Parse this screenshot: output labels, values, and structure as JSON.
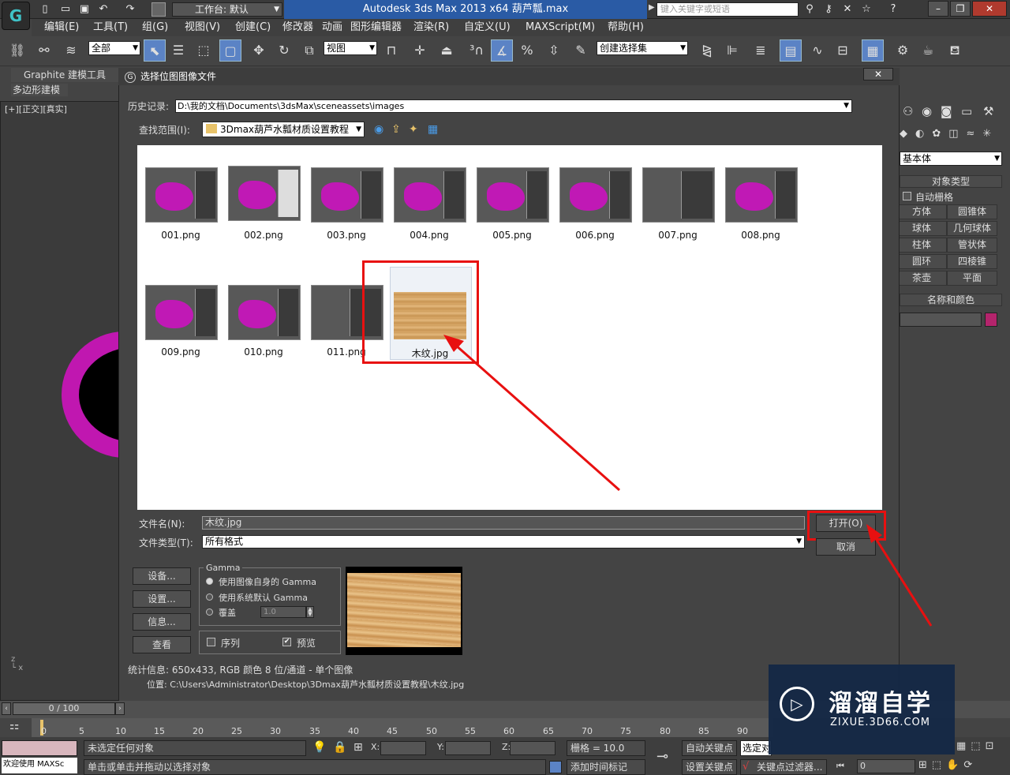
{
  "app": {
    "workspace": "工作台: 默认",
    "title": "Autodesk 3ds Max  2013 x64      葫芦瓢.max",
    "search_placeholder": "键入关键字或短语"
  },
  "menu": [
    "编辑(E)",
    "工具(T)",
    "组(G)",
    "视图(V)",
    "创建(C)",
    "修改器",
    "动画",
    "图形编辑器",
    "渲染(R)",
    "自定义(U)",
    "MAXScript(M)",
    "帮助(H)"
  ],
  "toolbar": {
    "selection_filter": "全部",
    "ref_coord": "视图",
    "selection_set": "创建选择集"
  },
  "ribbon": {
    "graphite_tab": "Graphite 建模工具",
    "poly_tab": "多边形建模"
  },
  "viewport": {
    "label": "[+][正交][真实]"
  },
  "right_panel": {
    "dropdown": "基本体",
    "object_type_header": "对象类型",
    "auto_grid": "自动栅格",
    "buttons": [
      [
        "方体",
        "圆锥体"
      ],
      [
        "球体",
        "几何球体"
      ],
      [
        "柱体",
        "管状体"
      ],
      [
        "圆环",
        "四棱锥"
      ],
      [
        "茶壶",
        "平面"
      ]
    ],
    "name_color_header": "名称和颜色",
    "object_color": "#b4246c"
  },
  "dialog": {
    "title": "选择位图图像文件",
    "history_label": "历史记录:",
    "history_value": "D:\\我的文档\\Documents\\3dsMax\\sceneassets\\images",
    "lookin_label": "查找范围(I):",
    "lookin_value": "3Dmax葫芦水瓢材质设置教程",
    "files": [
      "001.png",
      "002.png",
      "003.png",
      "004.png",
      "005.png",
      "006.png",
      "007.png",
      "008.png",
      "009.png",
      "010.png",
      "011.png",
      "木纹.jpg"
    ],
    "filename_label": "文件名(N):",
    "filename_value": "木纹.jpg",
    "filetype_label": "文件类型(T):",
    "filetype_value": "所有格式",
    "open_button": "打开(O)",
    "cancel_button": "取消",
    "setup_button": "设备...",
    "settings_button": "设置...",
    "info_button": "信息...",
    "view_button": "查看",
    "gamma_group": "Gamma",
    "gamma_options": [
      "使用图像自身的 Gamma",
      "使用系统默认 Gamma",
      "覆盖"
    ],
    "gamma_override_value": "1.0",
    "sequence_label": "序列",
    "preview_label": "预览",
    "stats": "统计信息: 650x433, RGB 颜色 8 位/通道 - 单个图像",
    "location": "位置: C:\\Users\\Administrator\\Desktop\\3Dmax葫芦水瓢材质设置教程\\木纹.jpg"
  },
  "timeline": {
    "frame": "0 / 100",
    "ticks": [
      "0",
      "5",
      "10",
      "15",
      "20",
      "25",
      "30",
      "35",
      "40",
      "45",
      "50",
      "55",
      "60",
      "65",
      "70",
      "75",
      "80",
      "85",
      "90"
    ]
  },
  "status": {
    "maxscript": "欢迎使用 MAXSc",
    "selection": "未选定任何对象",
    "prompt": "单击或单击并拖动以选择对象",
    "x_label": "X:",
    "y_label": "Y:",
    "z_label": "Z:",
    "grid": "栅格 = 10.0",
    "add_time_tag": "添加时间标记",
    "auto_key": "自动关键点",
    "set_key": "设置关键点",
    "selected_obj": "选定对",
    "key_filter": "关键点过滤器...",
    "frame_field": "0"
  },
  "watermark": {
    "title": "溜溜自学",
    "url": "ZIXUE.3D66.COM"
  }
}
